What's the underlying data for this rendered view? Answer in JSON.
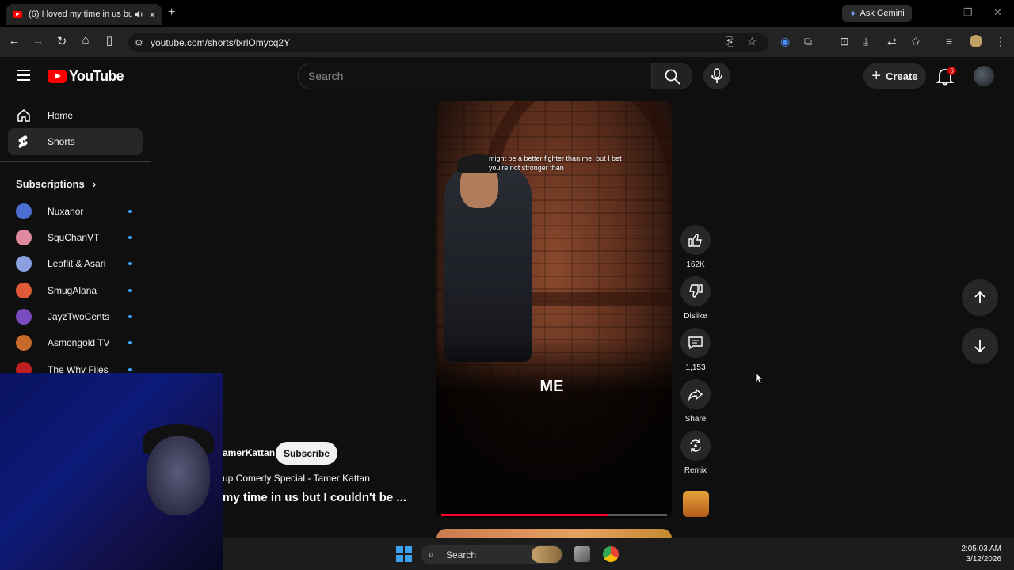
{
  "browser": {
    "tab_title": "(6) I loved my time in us bu",
    "tab_close": "×",
    "new_tab": "+",
    "gemini_label": "Ask Gemini",
    "url": "youtube.com/shorts/lxrlOmycq2Y"
  },
  "header": {
    "logo_text": "YouTube",
    "search_placeholder": "Search",
    "create_label": "Create",
    "notifications_count": "6"
  },
  "sidebar": {
    "items": [
      {
        "label": "Home"
      },
      {
        "label": "Shorts"
      }
    ],
    "subscriptions_heading": "Subscriptions",
    "subscriptions": [
      {
        "name": "Nuxanor",
        "color": "#4a6fd0"
      },
      {
        "name": "SquChanVT",
        "color": "#e08aa0"
      },
      {
        "name": "Leaflit & Asari",
        "color": "#8aa0e0"
      },
      {
        "name": "SmugAlana",
        "color": "#e05a3a"
      },
      {
        "name": "JayzTwoCents",
        "color": "#7a4ac0"
      },
      {
        "name": "Asmongold TV",
        "color": "#c86a2a"
      },
      {
        "name": "The Why Files",
        "color": "#c02020"
      }
    ]
  },
  "short": {
    "caption": "might be a better fighter than me, but I bet you're not stronger than",
    "overlay_text": "ME",
    "progress": 0.74,
    "channel": "amerKattan",
    "subscribe_label": "Subscribe",
    "sound": "up Comedy Special - Tamer Kattan",
    "title": "my time in us but I couldn't be ..."
  },
  "actions": {
    "like_count": "162K",
    "dislike_label": "Dislike",
    "comments_count": "1,153",
    "share_label": "Share",
    "remix_label": "Remix"
  },
  "taskbar": {
    "search_label": "Search",
    "time": "2:05:03 AM",
    "date": "3/12/2026"
  },
  "colors": {
    "accent_red": "#ff0000",
    "progress_red": "#ff0033",
    "background": "#0f0f0f"
  }
}
